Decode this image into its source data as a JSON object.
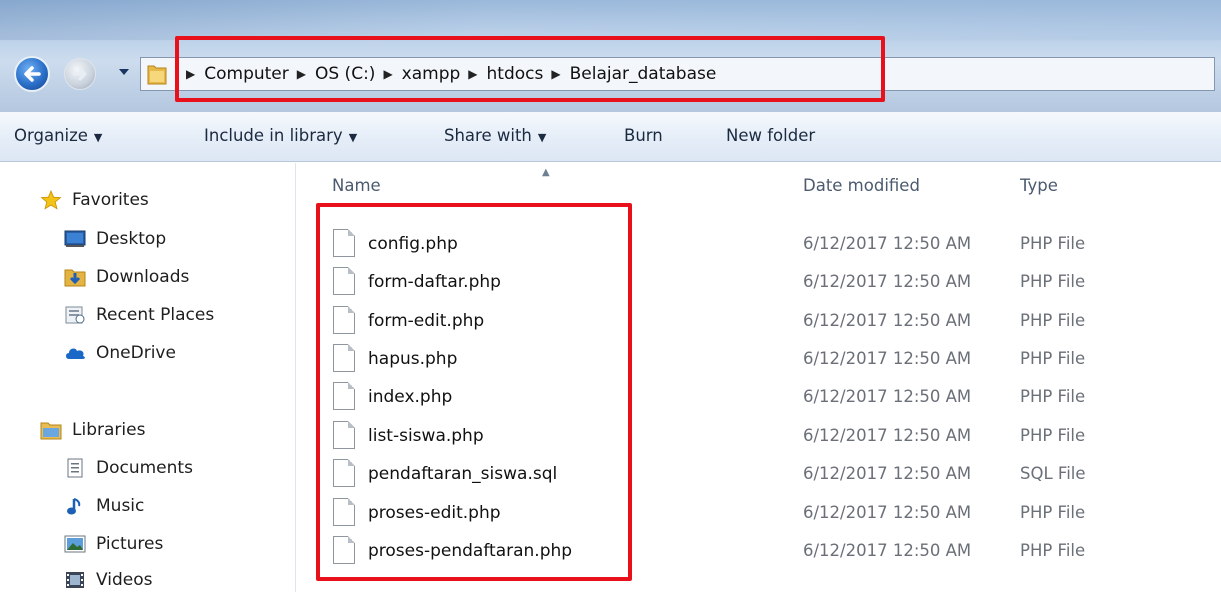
{
  "breadcrumb": [
    "Computer",
    "OS (C:)",
    "xampp",
    "htdocs",
    "Belajar_database"
  ],
  "toolbar": {
    "organize": "Organize",
    "include_in_library": "Include in library",
    "share_with": "Share with",
    "burn": "Burn",
    "new_folder": "New folder"
  },
  "sidebar": {
    "favorites": {
      "label": "Favorites",
      "items": [
        "Desktop",
        "Downloads",
        "Recent Places",
        "OneDrive"
      ]
    },
    "libraries": {
      "label": "Libraries",
      "items": [
        "Documents",
        "Music",
        "Pictures",
        "Videos"
      ]
    }
  },
  "columns": {
    "name": "Name",
    "date_modified": "Date modified",
    "type": "Type"
  },
  "files": [
    {
      "name": "config.php",
      "date": "6/12/2017 12:50 AM",
      "type": "PHP File"
    },
    {
      "name": "form-daftar.php",
      "date": "6/12/2017 12:50 AM",
      "type": "PHP File"
    },
    {
      "name": "form-edit.php",
      "date": "6/12/2017 12:50 AM",
      "type": "PHP File"
    },
    {
      "name": "hapus.php",
      "date": "6/12/2017 12:50 AM",
      "type": "PHP File"
    },
    {
      "name": "index.php",
      "date": "6/12/2017 12:50 AM",
      "type": "PHP File"
    },
    {
      "name": "list-siswa.php",
      "date": "6/12/2017 12:50 AM",
      "type": "PHP File"
    },
    {
      "name": "pendaftaran_siswa.sql",
      "date": "6/12/2017 12:50 AM",
      "type": "SQL File"
    },
    {
      "name": "proses-edit.php",
      "date": "6/12/2017 12:50 AM",
      "type": "PHP File"
    },
    {
      "name": "proses-pendaftaran.php",
      "date": "6/12/2017 12:50 AM",
      "type": "PHP File"
    }
  ],
  "colors": {
    "highlight": "#e8111b",
    "accent": "#2a6fc8"
  },
  "icons": {
    "nav": [
      "back-arrow-icon",
      "forward-arrow-icon",
      "history-dropdown-icon",
      "folder-icon"
    ],
    "favorites": [
      "star-icon",
      "desktop-icon",
      "downloads-icon",
      "recent-places-icon",
      "onedrive-icon"
    ],
    "libraries": [
      "libraries-icon",
      "documents-icon",
      "music-icon",
      "pictures-icon",
      "videos-icon"
    ],
    "file": "document-icon"
  }
}
